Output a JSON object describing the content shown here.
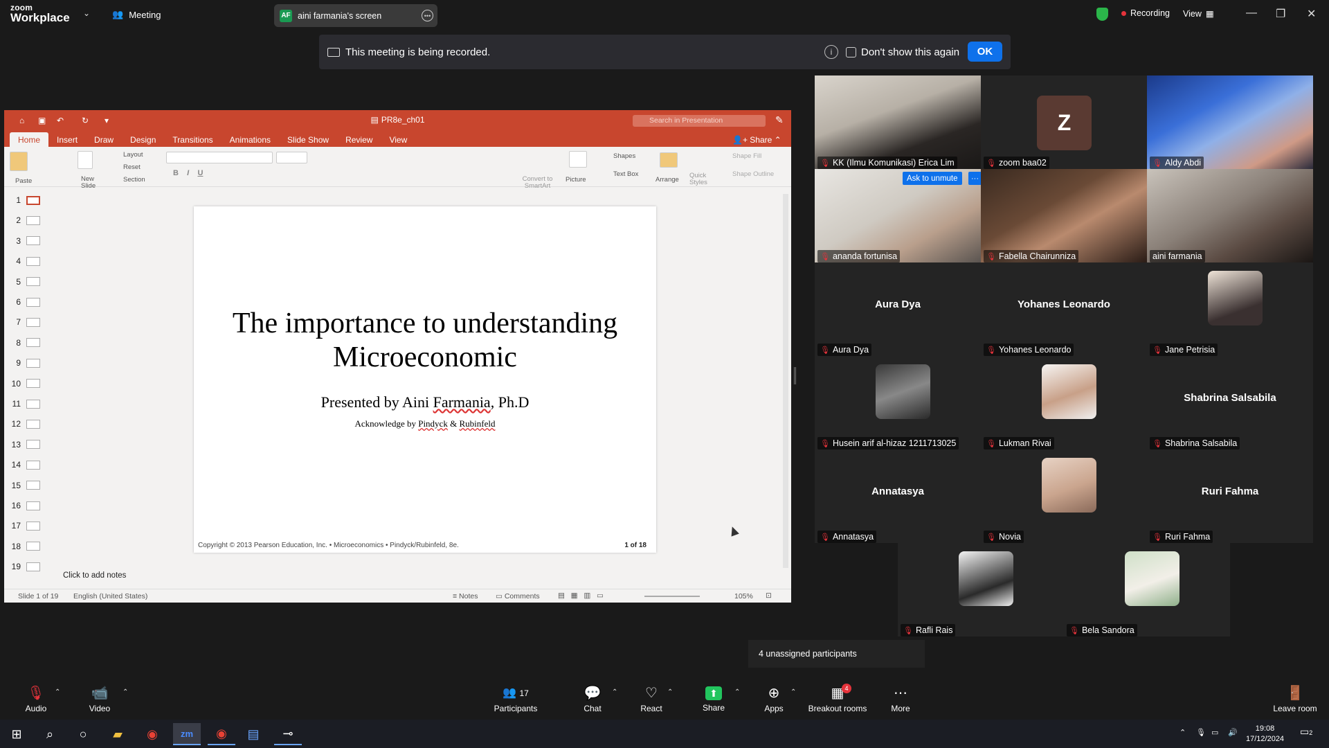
{
  "app": {
    "logo_line1": "zoom",
    "logo_line2": "Workplace",
    "meeting_label": "Meeting",
    "screen_tab_initials": "AF",
    "screen_tab_label": "aini farmania's screen",
    "recording_label": "Recording",
    "view_label": "View"
  },
  "banner": {
    "message": "This meeting is being recorded.",
    "dont_show": "Don't show this again",
    "ok": "OK"
  },
  "ppt": {
    "file_title": "PR8e_ch01",
    "search_placeholder": "Search in Presentation",
    "tabs": [
      "Home",
      "Insert",
      "Draw",
      "Design",
      "Transitions",
      "Animations",
      "Slide Show",
      "Review",
      "View"
    ],
    "share": "Share",
    "ribbon": {
      "paste": "Paste",
      "new_slide": "New Slide",
      "layout": "Layout",
      "reset": "Reset",
      "section": "Section",
      "convert": "Convert to SmartArt",
      "picture": "Picture",
      "shapes": "Shapes",
      "text_box": "Text Box",
      "arrange": "Arrange",
      "quick_styles": "Quick Styles",
      "shape_fill": "Shape Fill",
      "shape_outline": "Shape Outline"
    },
    "slide_numbers": [
      "1",
      "2",
      "3",
      "4",
      "5",
      "6",
      "7",
      "8",
      "9",
      "10",
      "11",
      "12",
      "13",
      "14",
      "15",
      "16",
      "17",
      "18",
      "19"
    ],
    "slide": {
      "title_line1": "The importance to understanding",
      "title_line2": "Microeconomic",
      "presented_prefix": "Presented by Aini ",
      "presented_name": "Farmania",
      "presented_suffix": ", Ph.D",
      "ack_prefix": "Acknowledge by ",
      "ack_name1": "Pindyck",
      "ack_amp": " & ",
      "ack_name2": "Rubinfeld",
      "footer": "Copyright © 2013  Pearson Education, Inc. •  Microeconomics  •  Pindyck/Rubinfeld, 8e.",
      "page": "1 of 18"
    },
    "notes_placeholder": "Click to add notes",
    "status": {
      "slide": "Slide 1 of 19",
      "language": "English (United States)",
      "notes": "Notes",
      "comments": "Comments",
      "zoom": "105%"
    }
  },
  "participants": [
    {
      "name": "KK (Ilmu Komunikasi) Erica Lim"
    },
    {
      "name": "zoom baa02",
      "initial": "Z"
    },
    {
      "name": "Aldy Abdi"
    },
    {
      "name": "ananda fortunisa",
      "ask_unmute": "Ask to unmute"
    },
    {
      "name": "Fabella Chairunniza"
    },
    {
      "name": "aini farmania"
    },
    {
      "name": "Aura Dya",
      "big": "Aura Dya"
    },
    {
      "name": "Yohanes Leonardo",
      "big": "Yohanes Leonardo"
    },
    {
      "name": "Jane Petrisia"
    },
    {
      "name": "Husein arif al-hizaz 1211713025"
    },
    {
      "name": "Lukman Rivai"
    },
    {
      "name": "Shabrina Salsabila",
      "big": "Shabrina Salsabila"
    },
    {
      "name": "Annatasya",
      "big": "Annatasya"
    },
    {
      "name": "Novia"
    },
    {
      "name": "Ruri Fahma",
      "big": "Ruri Fahma"
    },
    {
      "name": "Rafli Rais"
    },
    {
      "name": "Bela Sandora"
    }
  ],
  "unassigned": "4 unassigned participants",
  "toolbar": {
    "audio": "Audio",
    "video": "Video",
    "participants": "Participants",
    "participants_count": "17",
    "chat": "Chat",
    "react": "React",
    "share": "Share",
    "apps": "Apps",
    "breakout": "Breakout rooms",
    "breakout_badge": "4",
    "more": "More",
    "leave": "Leave room"
  },
  "taskbar": {
    "time": "19:08",
    "date": "17/12/2024",
    "notif": "2"
  },
  "colors": {
    "zoom_blue": "#0e71eb",
    "ppt_red": "#c8462e",
    "share_green": "#22c55e",
    "active_speaker": "#2bd47d"
  }
}
